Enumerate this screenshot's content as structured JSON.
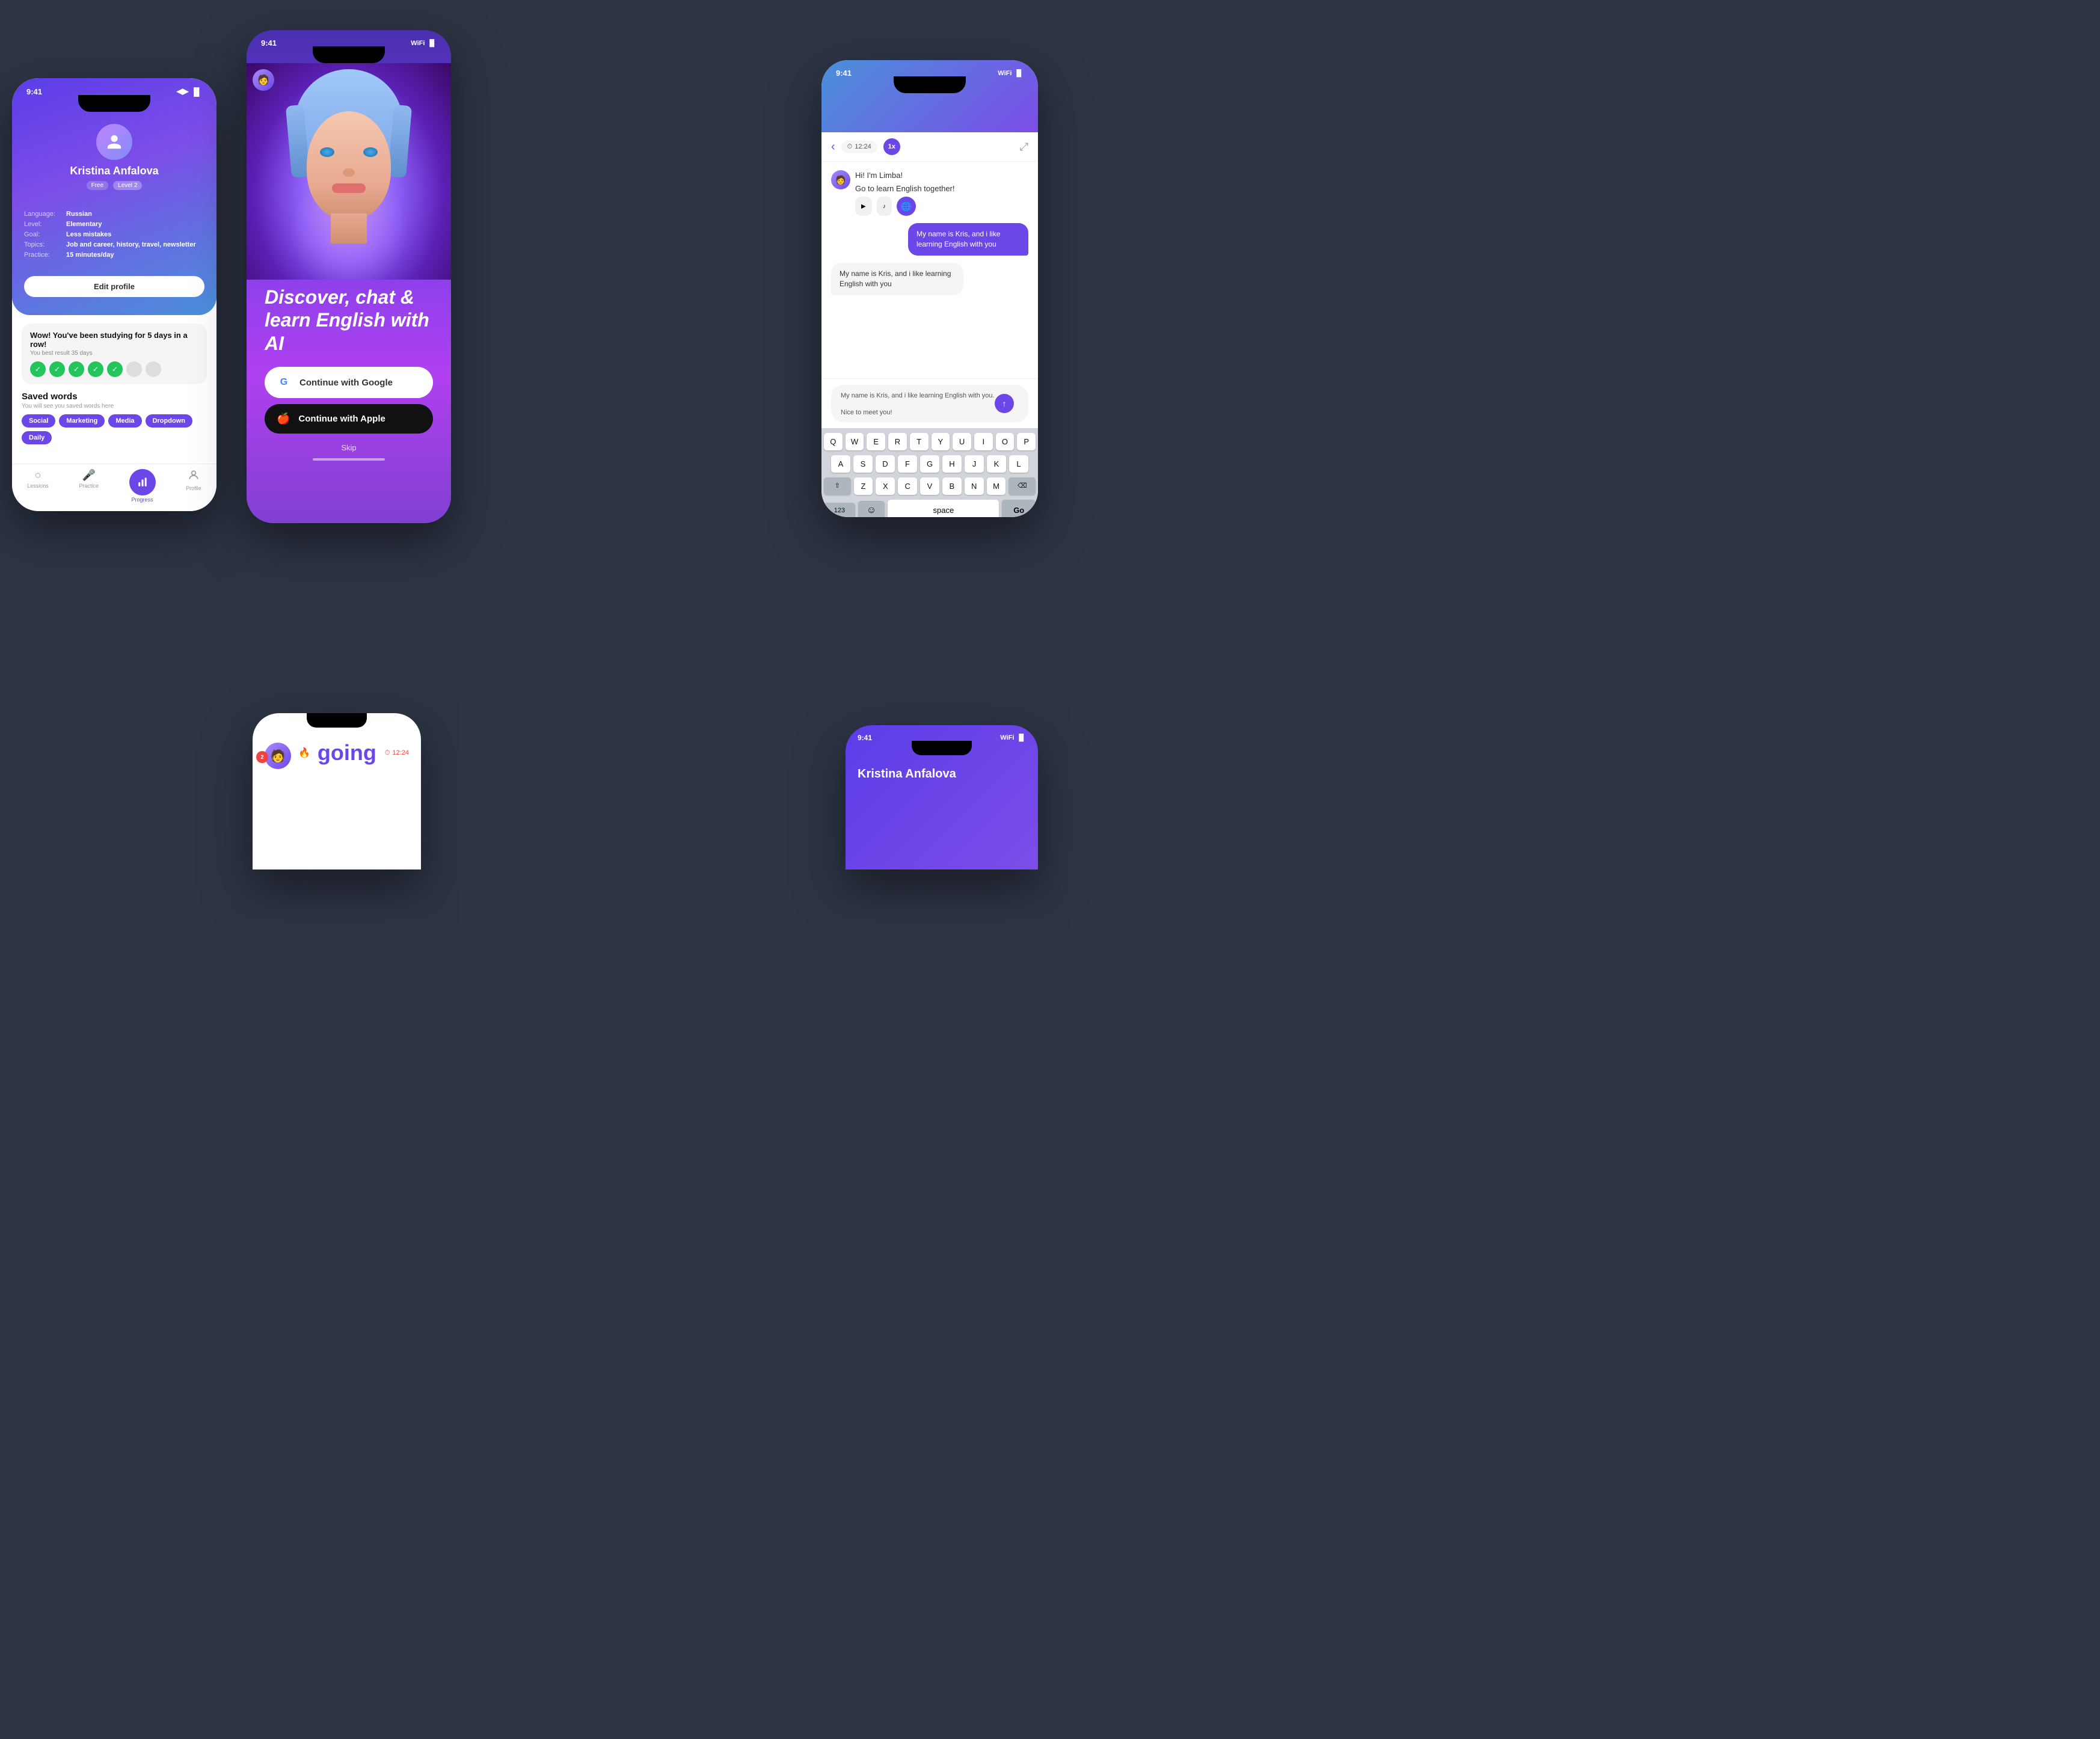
{
  "app": {
    "background_color": "#2d3545"
  },
  "phone1": {
    "time": "9:41",
    "user": {
      "name": "Kristina Anfalova",
      "badge_free": "Free",
      "badge_level": "Level 2",
      "language_label": "Language:",
      "language_value": "Russian",
      "level_label": "Level:",
      "level_value": "Elementary",
      "goal_label": "Goal:",
      "goal_value": "Less mistakes",
      "topics_label": "Topics:",
      "topics_value": "Job and career, history, travel, newsletter",
      "practice_label": "Practice:",
      "practice_value": "15 minutes/day"
    },
    "edit_button": "Edit profile",
    "streak": {
      "title": "Wow! You've been studying for 5 days in a row!",
      "subtitle": "You best result 35 days",
      "active_days": 5,
      "total_dots": 7
    },
    "saved_words": {
      "title": "Saved words",
      "subtitle": "You will see you saved words here",
      "words": [
        "Social",
        "Marketing",
        "Media",
        "Dropdown",
        "Daily"
      ]
    },
    "nav": {
      "items": [
        "Lessions",
        "Practice",
        "Progress",
        "Profile"
      ],
      "active": "Progress"
    }
  },
  "phone2": {
    "time": "9:41",
    "hero_title": "Discover, chat & learn English with AI",
    "google_button": "Continue with Google",
    "apple_button": "Continue with Apple",
    "skip_label": "Skip"
  },
  "phone3": {
    "time": "9:41",
    "timer": "12:24",
    "speed": "1x",
    "bot_name": "Limba",
    "messages": [
      {
        "type": "bot",
        "text": "Hi! I'm Limba!"
      },
      {
        "type": "bot",
        "text": "Go to learn English together!"
      },
      {
        "type": "user",
        "text": "My name is Kris, and i like learning English with you"
      },
      {
        "type": "bot",
        "text": "My name is Kris, and i like learning English with you"
      },
      {
        "type": "bot_input",
        "text": "My name is Kris, and i like learning English with you.\n\nNice to meet you!"
      }
    ],
    "keyboard": {
      "row1": [
        "Q",
        "W",
        "E",
        "R",
        "T",
        "Y",
        "U",
        "I",
        "O",
        "P"
      ],
      "row2": [
        "A",
        "S",
        "D",
        "F",
        "G",
        "H",
        "J",
        "K",
        "L"
      ],
      "row3": [
        "Z",
        "X",
        "C",
        "V",
        "B",
        "N",
        "M"
      ],
      "space": "space",
      "go": "Go",
      "numbers": "123"
    }
  },
  "phone4": {
    "timer": "12:24",
    "badge_count": "2",
    "going_text": "going"
  },
  "phone5": {
    "time": "9:41",
    "user_name": "Kristina Anfalova"
  }
}
